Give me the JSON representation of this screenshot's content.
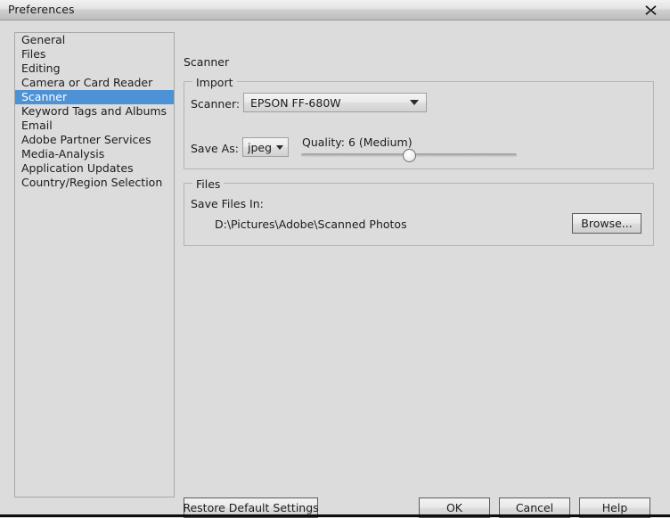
{
  "window": {
    "title": "Preferences",
    "close_icon": "close-icon"
  },
  "sidebar": {
    "items": [
      {
        "label": "General",
        "selected": false
      },
      {
        "label": "Files",
        "selected": false
      },
      {
        "label": "Editing",
        "selected": false
      },
      {
        "label": "Camera or Card Reader",
        "selected": false
      },
      {
        "label": "Scanner",
        "selected": true
      },
      {
        "label": "Keyword Tags and Albums",
        "selected": false
      },
      {
        "label": "Email",
        "selected": false
      },
      {
        "label": "Adobe Partner Services",
        "selected": false
      },
      {
        "label": "Media-Analysis",
        "selected": false
      },
      {
        "label": "Application Updates",
        "selected": false
      },
      {
        "label": "Country/Region Selection",
        "selected": false
      }
    ],
    "selection_color": "#4c92d4"
  },
  "main": {
    "pane_title": "Scanner",
    "import_group": {
      "legend": "Import",
      "scanner_label": "Scanner:",
      "scanner_value": "EPSON FF-680W",
      "scanner_arrow_icon": "chevron-down-icon",
      "save_as_label": "Save As:",
      "save_as_value": "jpeg",
      "save_as_arrow_icon": "chevron-down-icon",
      "quality_label": "Quality: 6 (Medium)",
      "quality_value": 6,
      "quality_min": 0,
      "quality_max": 12,
      "quality_percent": 50
    },
    "files_group": {
      "legend": "Files",
      "save_files_in_label": "Save Files In:",
      "save_path": "D:\\Pictures\\Adobe\\Scanned Photos",
      "browse_label": "Browse..."
    }
  },
  "footer": {
    "restore_label": "Restore Default Settings",
    "ok_label": "OK",
    "cancel_label": "Cancel",
    "help_label": "Help"
  }
}
